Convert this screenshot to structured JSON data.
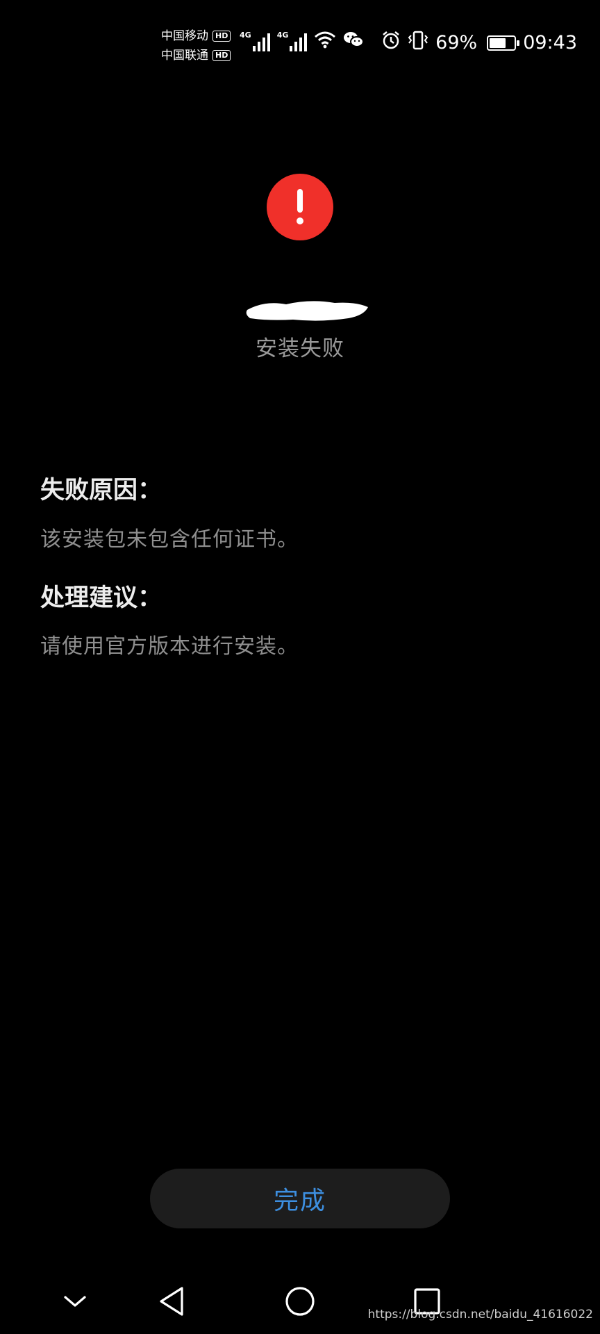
{
  "status_bar": {
    "carriers": [
      {
        "name": "中国移动",
        "badge": "HD"
      },
      {
        "name": "中国联通",
        "badge": "HD"
      }
    ],
    "network_types": [
      "4G",
      "4G"
    ],
    "battery_percent": "69%",
    "battery_level": 0.69,
    "time": "09:43",
    "icons": [
      "wifi-icon",
      "wechat-icon",
      "alarm-icon",
      "vibrate-icon",
      "battery-icon"
    ]
  },
  "main": {
    "status_icon": "alert-icon",
    "status_color": "#f0302a",
    "status_text": "安装失败",
    "sections": [
      {
        "heading": "失败原因：",
        "body": "该安装包未包含任何证书。"
      },
      {
        "heading": "处理建议：",
        "body": "请使用官方版本进行安装。"
      }
    ]
  },
  "actions": {
    "done_label": "完成",
    "accent": "#3d8fe0"
  },
  "nav_bar": {
    "icons": [
      "chevron-down-icon",
      "back-icon",
      "home-icon",
      "recents-icon"
    ]
  },
  "watermark": "https://blog.csdn.net/baidu_41616022"
}
